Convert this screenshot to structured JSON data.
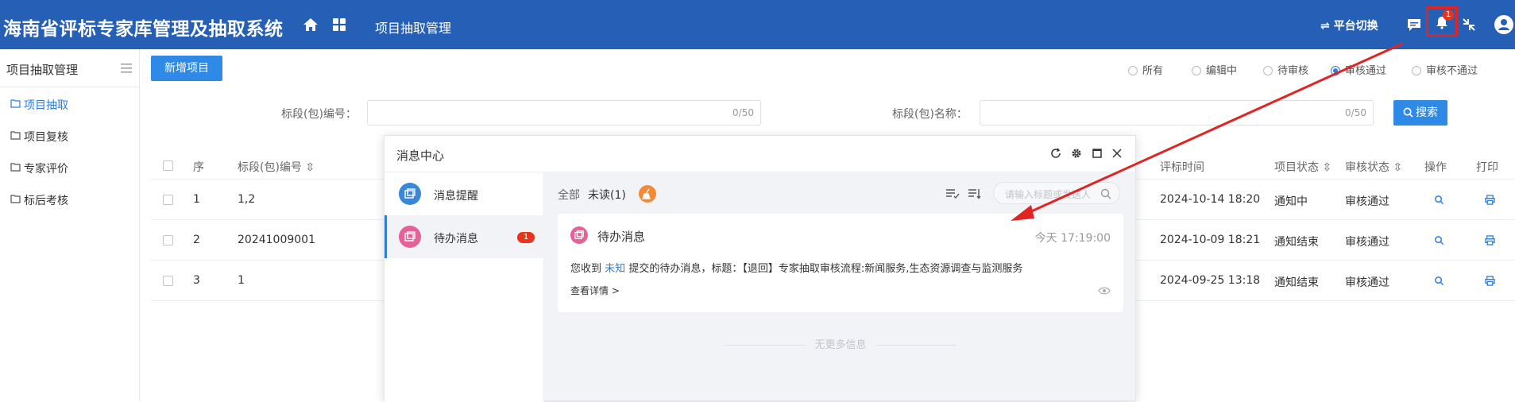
{
  "header": {
    "app_title": "海南省评标专家库管理及抽取系统",
    "nav_label": "项目抽取管理",
    "switch_label": "⇌ 平台切换",
    "bell_count": "1",
    "colors": {
      "bar": "#2560b6",
      "highlight": "#e02424"
    }
  },
  "sidebar": {
    "title": "项目抽取管理",
    "items": [
      {
        "label": "项目抽取",
        "active": true
      },
      {
        "label": "项目复核"
      },
      {
        "label": "专家评价"
      },
      {
        "label": "标后考核"
      }
    ]
  },
  "toolbar": {
    "add_button": "新增项目",
    "filters": [
      "所有",
      "编辑中",
      "待审核",
      "审核通过",
      "审核不通过"
    ],
    "filter_selected": "审核通过",
    "search_button": "搜索"
  },
  "search": {
    "code_label": "标段(包)编号：",
    "code_count": "0/50",
    "name_label": "标段(包)名称：",
    "name_count": "0/50"
  },
  "table": {
    "headers": {
      "no": "序",
      "code": "标段(包)编号",
      "eval_time": "评标时间",
      "project_status": "项目状态",
      "review_status": "审核状态",
      "action": "操作",
      "print": "打印"
    },
    "rows": [
      {
        "no": "1",
        "code": "1,2",
        "eval_time": "2024-10-14 18:20",
        "project_status": "通知中",
        "review_status": "审核通过"
      },
      {
        "no": "2",
        "code": "20241009001",
        "eval_time": "2024-10-09 18:21",
        "project_status": "通知结束",
        "review_status": "审核通过"
      },
      {
        "no": "3",
        "code": "1",
        "eval_time": "2024-09-25 13:18",
        "project_status": "通知结束",
        "review_status": "审核通过"
      }
    ]
  },
  "message_center": {
    "title": "消息中心",
    "categories": [
      {
        "label": "消息提醒",
        "color": "#3a86d8"
      },
      {
        "label": "待办消息",
        "color": "#e5619a",
        "badge": "1",
        "active": true
      }
    ],
    "filter_all": "全部",
    "filter_unread": "未读(1)",
    "search_placeholder": "请输入标题或发送人",
    "card": {
      "title": "待办消息",
      "time": "今天 17:19:00",
      "body_prefix": "您收到",
      "sender": "未知",
      "body_suffix": "提交的待办消息，标题：【退回】专家抽取审核流程:新闻服务,生态资源调查与监测服务",
      "more": "查看详情 >"
    },
    "no_more": "无更多信息"
  }
}
